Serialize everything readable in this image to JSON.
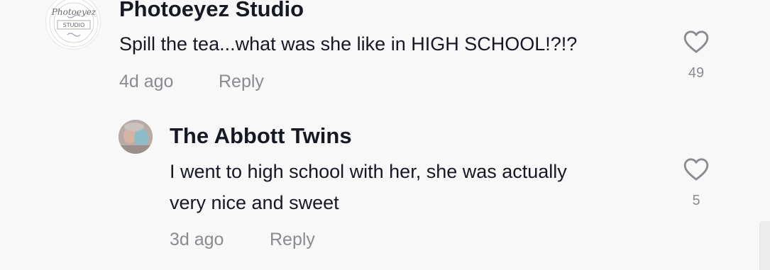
{
  "comments": [
    {
      "author": "Photoeyez Studio",
      "avatar_text": [
        "Photoeyez",
        "STUDIO"
      ],
      "lines": [
        "Spill the tea...what was she like in HIGH SCHOOL!?!?"
      ],
      "time": "4d ago",
      "reply_label": "Reply",
      "likes": "49"
    }
  ],
  "replies": [
    {
      "author": "The Abbott Twins",
      "lines": [
        "I went to high school with her, she was actually",
        "very nice and sweet"
      ],
      "time": "3d ago",
      "reply_label": "Reply",
      "likes": "5"
    }
  ],
  "colors": {
    "background": "#f8f8f8",
    "text_primary": "#161823",
    "text_secondary": "#8a8b91"
  },
  "icons": {
    "like": "heart-outline-icon"
  }
}
